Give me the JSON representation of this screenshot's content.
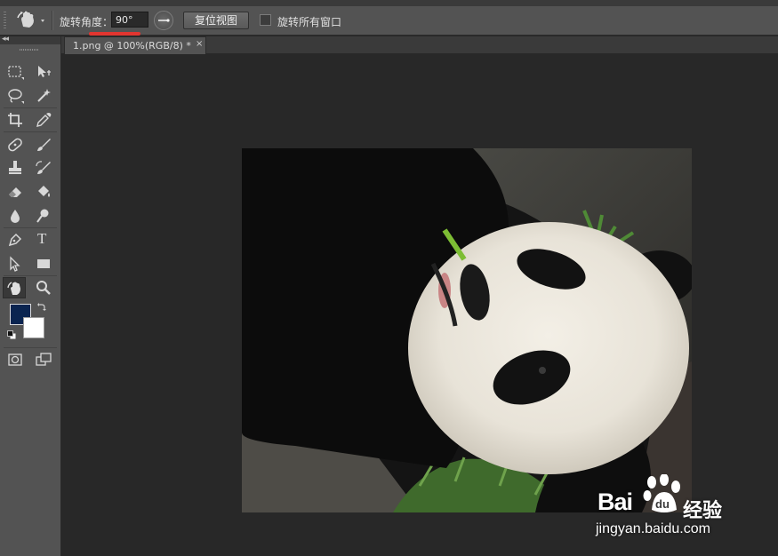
{
  "options_bar": {
    "tool_icon": "rotate-view-icon",
    "rotation_angle_label": "旋转角度：",
    "rotation_angle_value": "90°",
    "reset_view_button": "复位视图",
    "rotate_all_windows_label": "旋转所有窗口",
    "rotate_all_windows_checked": false,
    "highlight_color": "#e23530"
  },
  "document_tab": {
    "title": "1.png @ 100%(RGB/8) *",
    "close": "×"
  },
  "toolbar": {
    "collapse": "◂◂",
    "tools": [
      "rectangular-marquee-icon",
      "move-icon",
      "lasso-icon",
      "magic-wand-icon",
      "crop-icon",
      "eyedropper-icon",
      "healing-brush-icon",
      "brush-icon",
      "clone-stamp-icon",
      "history-brush-icon",
      "eraser-icon",
      "paint-bucket-icon",
      "blur-icon",
      "dodge-icon",
      "pen-icon",
      "type-icon",
      "path-selection-icon",
      "rectangle-shape-icon",
      "rotate-view-icon",
      "zoom-icon"
    ],
    "type_tool_glyph": "T",
    "foreground_color": "#0a2450",
    "background_color": "#ffffff"
  },
  "watermark": {
    "logo": "Bai",
    "paw": "paw-icon",
    "du": "du",
    "cn": "经验",
    "url": "jingyan.baidu.com"
  }
}
